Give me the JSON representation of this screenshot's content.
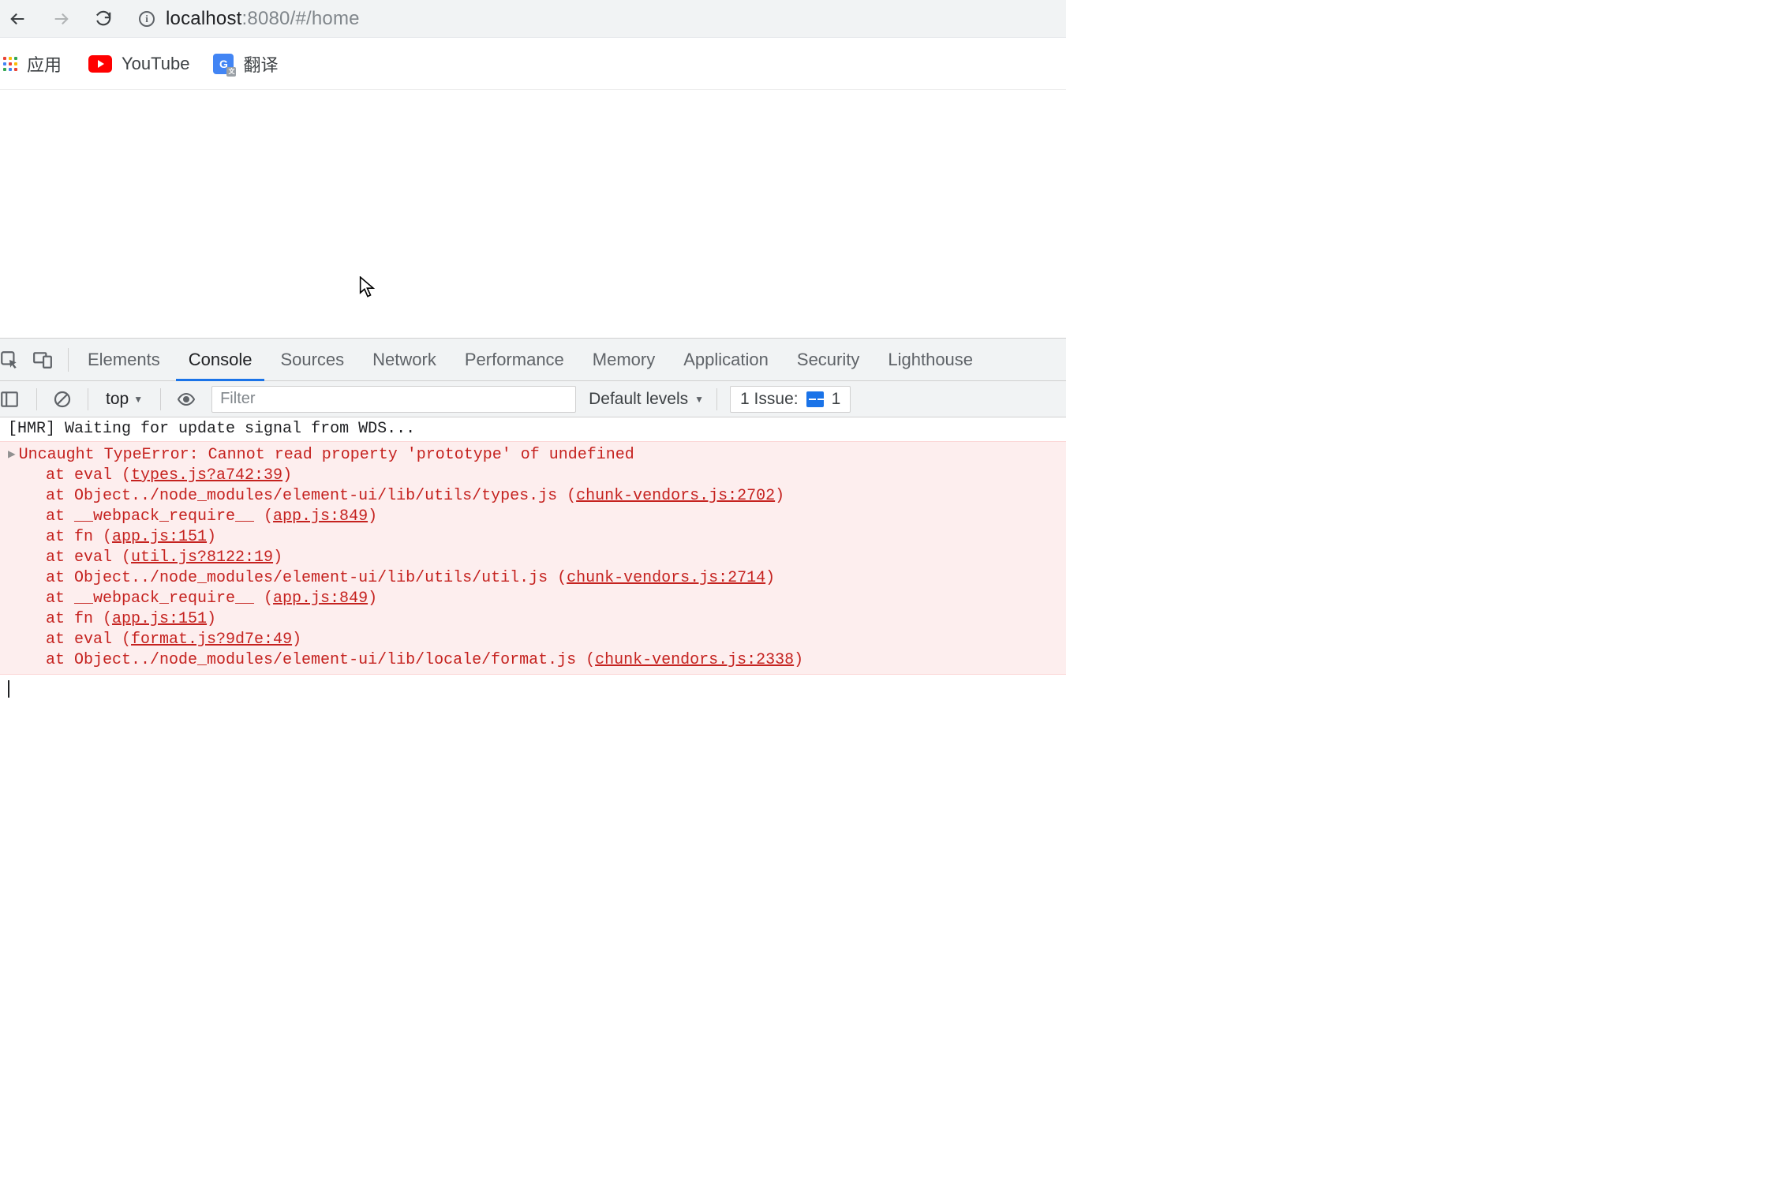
{
  "browser": {
    "url_host": "localhost",
    "url_rest": ":8080/#/home"
  },
  "bookmarks": {
    "apps": "应用",
    "youtube": "YouTube",
    "translate": "翻译"
  },
  "devtools": {
    "tabs": {
      "elements": "Elements",
      "console": "Console",
      "sources": "Sources",
      "network": "Network",
      "performance": "Performance",
      "memory": "Memory",
      "application": "Application",
      "security": "Security",
      "lighthouse": "Lighthouse"
    },
    "filter_bar": {
      "context": "top",
      "filter_placeholder": "Filter",
      "levels": "Default levels",
      "issues_label": "1 Issue:",
      "issues_count": "1"
    },
    "console_log": {
      "hmr": "[HMR] Waiting for update signal from WDS...",
      "error_msg": "Uncaught TypeError: Cannot read property 'prototype' of undefined",
      "stack": [
        {
          "prefix": "at eval (",
          "link": "types.js?a742:39",
          "suffix": ")"
        },
        {
          "prefix": "at Object../node_modules/element-ui/lib/utils/types.js (",
          "link": "chunk-vendors.js:2702",
          "suffix": ")"
        },
        {
          "prefix": "at __webpack_require__ (",
          "link": "app.js:849",
          "suffix": ")"
        },
        {
          "prefix": "at fn (",
          "link": "app.js:151",
          "suffix": ")"
        },
        {
          "prefix": "at eval (",
          "link": "util.js?8122:19",
          "suffix": ")"
        },
        {
          "prefix": "at Object../node_modules/element-ui/lib/utils/util.js (",
          "link": "chunk-vendors.js:2714",
          "suffix": ")"
        },
        {
          "prefix": "at __webpack_require__ (",
          "link": "app.js:849",
          "suffix": ")"
        },
        {
          "prefix": "at fn (",
          "link": "app.js:151",
          "suffix": ")"
        },
        {
          "prefix": "at eval (",
          "link": "format.js?9d7e:49",
          "suffix": ")"
        },
        {
          "prefix": "at Object../node_modules/element-ui/lib/locale/format.js (",
          "link": "chunk-vendors.js:2338",
          "suffix": ")"
        }
      ]
    }
  }
}
